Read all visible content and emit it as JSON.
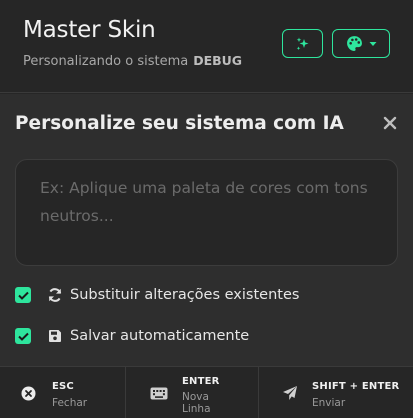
{
  "header": {
    "title": "Master Skin",
    "subtitle": "Personalizando o sistema",
    "badge": "DEBUG",
    "magic_button_icon": "sparkles-icon",
    "palette_button_icon": "palette-icon"
  },
  "panel": {
    "title": "Personalize seu sistema com IA",
    "close_icon": "close-icon",
    "prompt_placeholder": "Ex: Aplique uma paleta de cores com tons neutros..."
  },
  "options": [
    {
      "label": "Substituir alterações existentes",
      "checked": true,
      "icon": "sync-icon"
    },
    {
      "label": "Salvar automaticamente",
      "checked": true,
      "icon": "save-icon"
    }
  ],
  "shortcuts": [
    {
      "key": "ESC",
      "action": "Fechar",
      "icon": "close-circle-icon"
    },
    {
      "key": "ENTER",
      "action": "Nova Linha",
      "icon": "keyboard-icon"
    },
    {
      "key": "SHIFT + ENTER",
      "action": "Enviar",
      "icon": "send-icon"
    }
  ],
  "colors": {
    "accent": "#2ee59d",
    "background": "#262626",
    "panel": "#2e2e2e"
  }
}
